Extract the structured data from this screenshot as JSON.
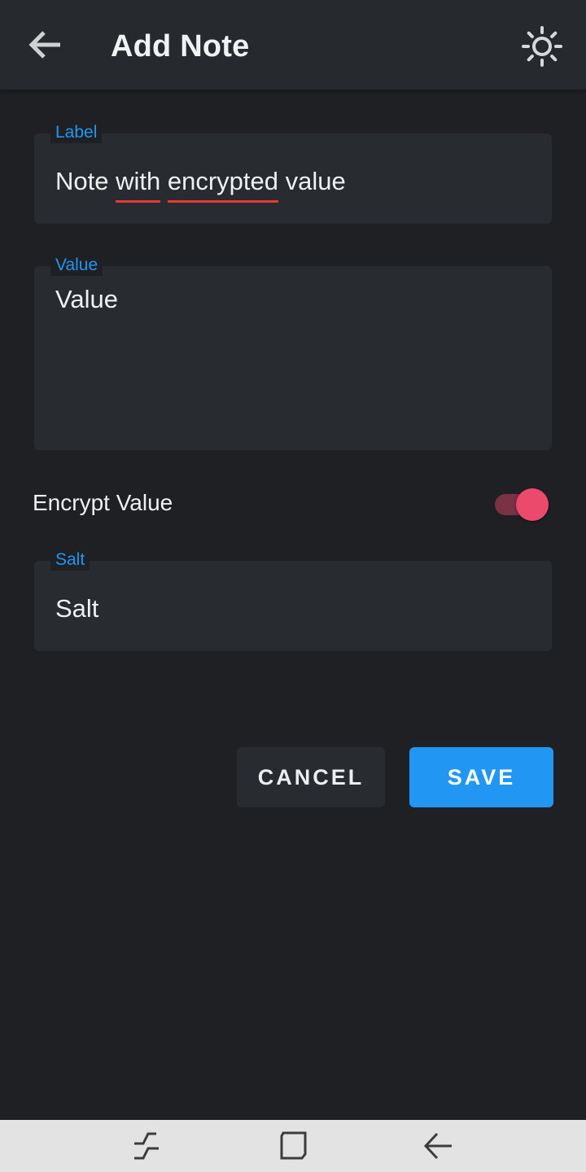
{
  "header": {
    "title": "Add Note",
    "back_icon": "arrow-back-icon",
    "theme_icon": "sun-icon"
  },
  "form": {
    "label_field": {
      "label": "Label",
      "value_parts": [
        "Note ",
        "with",
        " ",
        "encrypted",
        " value"
      ]
    },
    "value_field": {
      "label": "Value",
      "placeholder": "Value"
    },
    "encrypt": {
      "label": "Encrypt Value",
      "enabled": true
    },
    "salt_field": {
      "label": "Salt",
      "placeholder": "Salt"
    }
  },
  "actions": {
    "cancel_label": "CANCEL",
    "save_label": "SAVE"
  },
  "nav": {
    "recent_icon": "recent-apps-icon",
    "home_icon": "home-icon",
    "back_icon": "nav-back-icon"
  },
  "colors": {
    "accent": "#2196f3",
    "toggle_on": "#eb4a6c",
    "background": "#1e2024",
    "appbar": "#26292d",
    "field": "#282b2f"
  }
}
